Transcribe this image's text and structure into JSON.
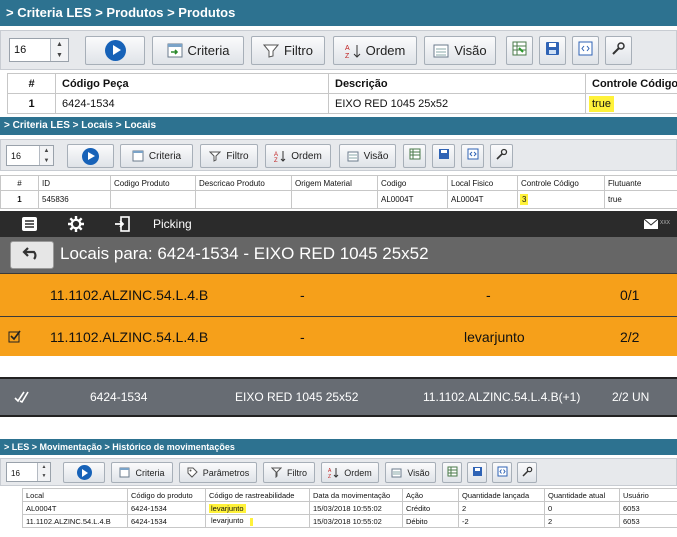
{
  "produtos": {
    "breadcrumb": "> Criteria LES > Produtos > Produtos",
    "page_size": "16",
    "buttons": {
      "criteria": "Criteria",
      "filtro": "Filtro",
      "ordem": "Ordem",
      "visao": "Visão"
    },
    "columns": [
      "#",
      "Código Peça",
      "Descrição",
      "Controle Código"
    ],
    "rows": [
      [
        "1",
        "6424-1534",
        "EIXO RED 1045 25x52",
        "true"
      ]
    ]
  },
  "locais": {
    "breadcrumb": "> Criteria LES > Locais > Locais",
    "page_size": "16",
    "buttons": {
      "criteria": "Criteria",
      "filtro": "Filtro",
      "ordem": "Ordem",
      "visao": "Visão"
    },
    "columns": [
      "#",
      "ID",
      "Codigo Produto",
      "Descricao Produto",
      "Origem Material",
      "Codigo",
      "Local Fisico",
      "Controle Código",
      "Flutuante"
    ],
    "rows": [
      [
        "1",
        "545836",
        "",
        "",
        "",
        "AL0004T",
        "AL0004T",
        "3",
        "true"
      ]
    ]
  },
  "picking": {
    "title": "Picking",
    "badge": "XXX",
    "heading": "Locais para: 6424-1534 - EIXO RED 1045 25x52",
    "rows": [
      {
        "location": "11.1102.ALZINC.54.L.4.B",
        "col2": "-",
        "col3": "-",
        "qty": "0/1",
        "checked": false
      },
      {
        "location": "11.1102.ALZINC.54.L.4.B",
        "col2": "-",
        "col3": "levarjunto",
        "qty": "2/2",
        "checked": true
      }
    ],
    "summary": {
      "code": "6424-1534",
      "description": "EIXO RED 1045 25x52",
      "location": "11.1102.ALZINC.54.L.4.B(+1)",
      "qty": "2/2 UN"
    }
  },
  "movimentacao": {
    "breadcrumb": "> LES > Movimentação > Histórico de movimentações",
    "page_size": "16",
    "buttons": {
      "criteria": "Criteria",
      "parametros": "Parâmetros",
      "filtro": "Filtro",
      "ordem": "Ordem",
      "visao": "Visão"
    },
    "columns": [
      "Local",
      "Código do produto",
      "Código de rastreabilidade",
      "Data da movimentação",
      "Ação",
      "Quantidade lançada",
      "Quantidade atual",
      "Usuário"
    ],
    "rows": [
      [
        "AL0004T",
        "6424-1534",
        "levarjunto",
        "15/03/2018 10:55:02",
        "Crédito",
        "2",
        "0",
        "6053"
      ],
      [
        "11.1102.ALZINC.54.L.4.B",
        "6424-1534",
        "levarjunto",
        "15/03/2018 10:55:02",
        "Débito",
        "-2",
        "2",
        "6053"
      ]
    ]
  },
  "colors": {
    "header_blue": "#2d7290",
    "picking_orange": "#f6a01a",
    "highlight_yellow": "#fff23a"
  }
}
